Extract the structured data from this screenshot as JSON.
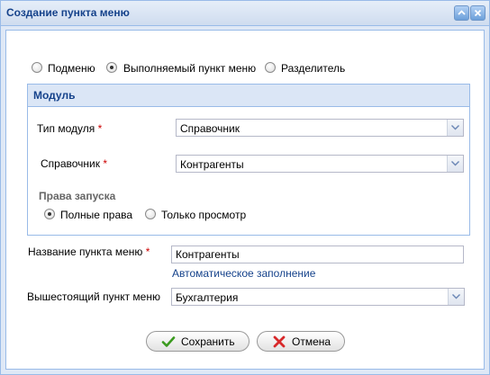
{
  "window": {
    "title": "Создание пункта меню"
  },
  "menu_type": {
    "options": [
      {
        "label": "Подменю",
        "checked": false
      },
      {
        "label": "Выполняемый пункт меню",
        "checked": true
      },
      {
        "label": "Разделитель",
        "checked": false
      }
    ]
  },
  "module": {
    "header": "Модуль",
    "type_label": "Тип модуля",
    "type_value": "Справочник",
    "ref_label": "Справочник",
    "ref_value": "Контрагенты",
    "rights_title": "Права запуска",
    "rights": [
      {
        "label": "Полные права",
        "checked": true
      },
      {
        "label": "Только просмотр",
        "checked": false
      }
    ]
  },
  "required_mark": "*",
  "name_field": {
    "label": "Название пункта меню",
    "value": "Контрагенты",
    "autofill_link": "Автоматическое заполнение"
  },
  "parent_field": {
    "label": "Вышестоящий пункт меню",
    "value": "Бухгалтерия"
  },
  "buttons": {
    "save": "Сохранить",
    "cancel": "Отмена"
  },
  "icons": {
    "minimize": "collapse-icon",
    "close": "close-icon",
    "save": "check-icon",
    "cancel": "x-icon"
  }
}
